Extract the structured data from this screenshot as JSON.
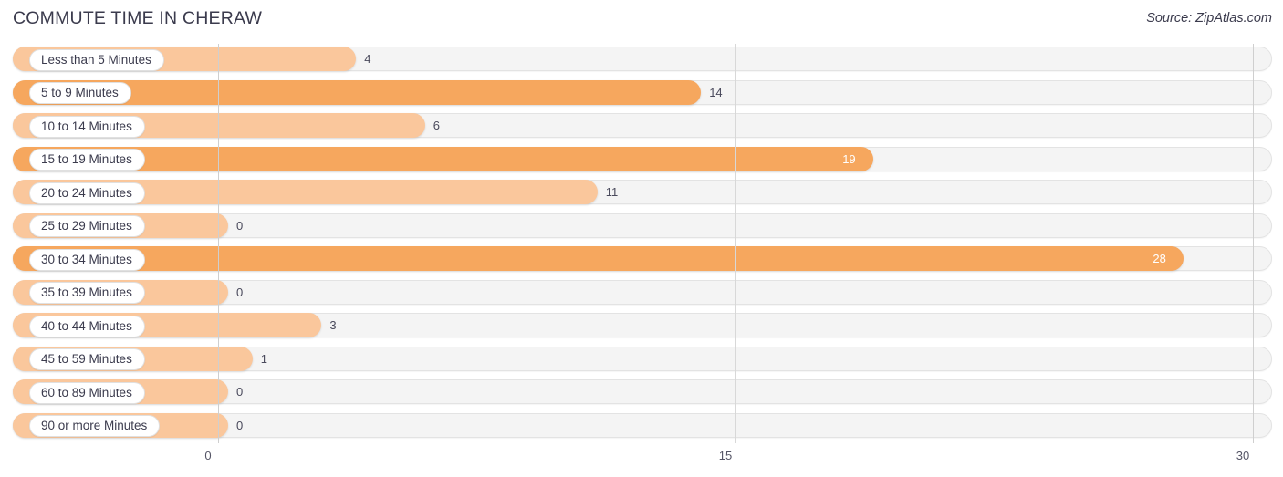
{
  "header": {
    "title": "COMMUTE TIME IN CHERAW",
    "source": "Source: ZipAtlas.com"
  },
  "colors": {
    "bar_light": "#fac79c",
    "bar_dark": "#f6a75e",
    "track": "#f4f4f4",
    "gridline": "#d8d8d8",
    "text": "#3b3b4d"
  },
  "chart_data": {
    "type": "bar",
    "orientation": "horizontal",
    "title": "COMMUTE TIME IN CHERAW",
    "subtitle": "Source: ZipAtlas.com",
    "xlabel": "",
    "ylabel": "",
    "xlim": [
      0,
      30
    ],
    "xticks": [
      0,
      15,
      30
    ],
    "xtick_labels": [
      "0",
      "15",
      "30"
    ],
    "grid": true,
    "legend": false,
    "categories": [
      "Less than 5 Minutes",
      "5 to 9 Minutes",
      "10 to 14 Minutes",
      "15 to 19 Minutes",
      "20 to 24 Minutes",
      "25 to 29 Minutes",
      "30 to 34 Minutes",
      "35 to 39 Minutes",
      "40 to 44 Minutes",
      "45 to 59 Minutes",
      "60 to 89 Minutes",
      "90 or more Minutes"
    ],
    "values": [
      4,
      14,
      6,
      19,
      11,
      0,
      28,
      0,
      3,
      1,
      0,
      0
    ],
    "value_labels": [
      "4",
      "14",
      "6",
      "19",
      "11",
      "0",
      "28",
      "0",
      "3",
      "1",
      "0",
      "0"
    ],
    "rows": [
      {
        "label": "Less than 5 Minutes",
        "value": 4,
        "value_label": "4",
        "shade": "light",
        "label_inside": false
      },
      {
        "label": "5 to 9 Minutes",
        "value": 14,
        "value_label": "14",
        "shade": "dark",
        "label_inside": false
      },
      {
        "label": "10 to 14 Minutes",
        "value": 6,
        "value_label": "6",
        "shade": "light",
        "label_inside": false
      },
      {
        "label": "15 to 19 Minutes",
        "value": 19,
        "value_label": "19",
        "shade": "dark",
        "label_inside": true
      },
      {
        "label": "20 to 24 Minutes",
        "value": 11,
        "value_label": "11",
        "shade": "light",
        "label_inside": false
      },
      {
        "label": "25 to 29 Minutes",
        "value": 0,
        "value_label": "0",
        "shade": "light",
        "label_inside": false
      },
      {
        "label": "30 to 34 Minutes",
        "value": 28,
        "value_label": "28",
        "shade": "dark",
        "label_inside": true
      },
      {
        "label": "35 to 39 Minutes",
        "value": 0,
        "value_label": "0",
        "shade": "light",
        "label_inside": false
      },
      {
        "label": "40 to 44 Minutes",
        "value": 3,
        "value_label": "3",
        "shade": "light",
        "label_inside": false
      },
      {
        "label": "45 to 59 Minutes",
        "value": 1,
        "value_label": "1",
        "shade": "light",
        "label_inside": false
      },
      {
        "label": "60 to 89 Minutes",
        "value": 0,
        "value_label": "0",
        "shade": "light",
        "label_inside": false
      },
      {
        "label": "90 or more Minutes",
        "value": 0,
        "value_label": "0",
        "shade": "light",
        "label_inside": false
      }
    ]
  }
}
